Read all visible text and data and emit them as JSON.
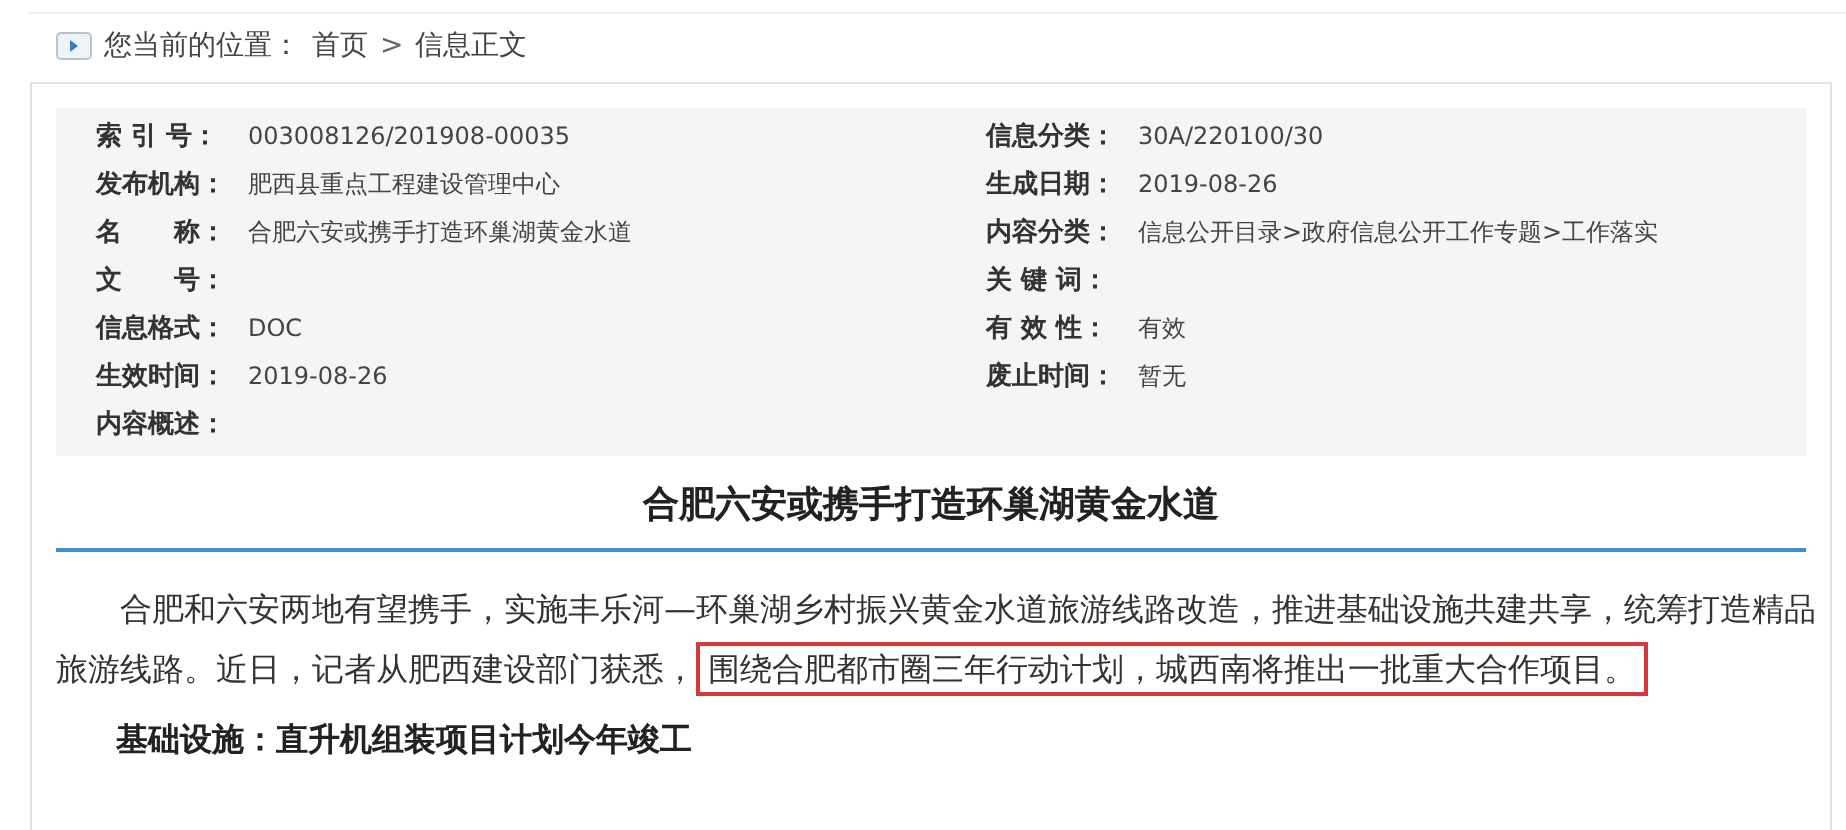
{
  "breadcrumb": {
    "label": "您当前的位置：",
    "items": [
      "首页",
      "信息正文"
    ],
    "separator": ">"
  },
  "info": {
    "left": [
      {
        "label": "索 引 号：",
        "value": "003008126/201908-00035"
      },
      {
        "label": "发布机构：",
        "value": "肥西县重点工程建设管理中心"
      },
      {
        "label": "名　　称：",
        "value": "合肥六安或携手打造环巢湖黄金水道"
      },
      {
        "label": "文　　号："
      },
      {
        "label": "信息格式：",
        "value": "DOC"
      },
      {
        "label": "生效时间：",
        "value": "2019-08-26"
      },
      {
        "label": "内容概述："
      }
    ],
    "right": [
      {
        "label": "信息分类：",
        "value": "30A/220100/30"
      },
      {
        "label": "生成日期：",
        "value": "2019-08-26"
      },
      {
        "label": "内容分类：",
        "value": "信息公开目录>政府信息公开工作专题>工作落实"
      },
      {
        "label": "关 键 词："
      },
      {
        "label": "有 效 性：",
        "value": "有效"
      },
      {
        "label": "废止时间：",
        "value": "暂无"
      }
    ]
  },
  "article": {
    "title": "合肥六安或携手打造环巢湖黄金水道",
    "paragraph": "合肥和六安两地有望携手，实施丰乐河—环巢湖乡村振兴黄金水道旅游线路改造，推进基础设施共建共享，统筹打造精品旅游线路。近日，记者从肥西建设部门获悉，",
    "highlighted": "围绕合肥都市圈三年行动计划，城西南将推出一批重大合作项目。",
    "subheading": "基础设施：直升机组装项目计划今年竣工"
  }
}
